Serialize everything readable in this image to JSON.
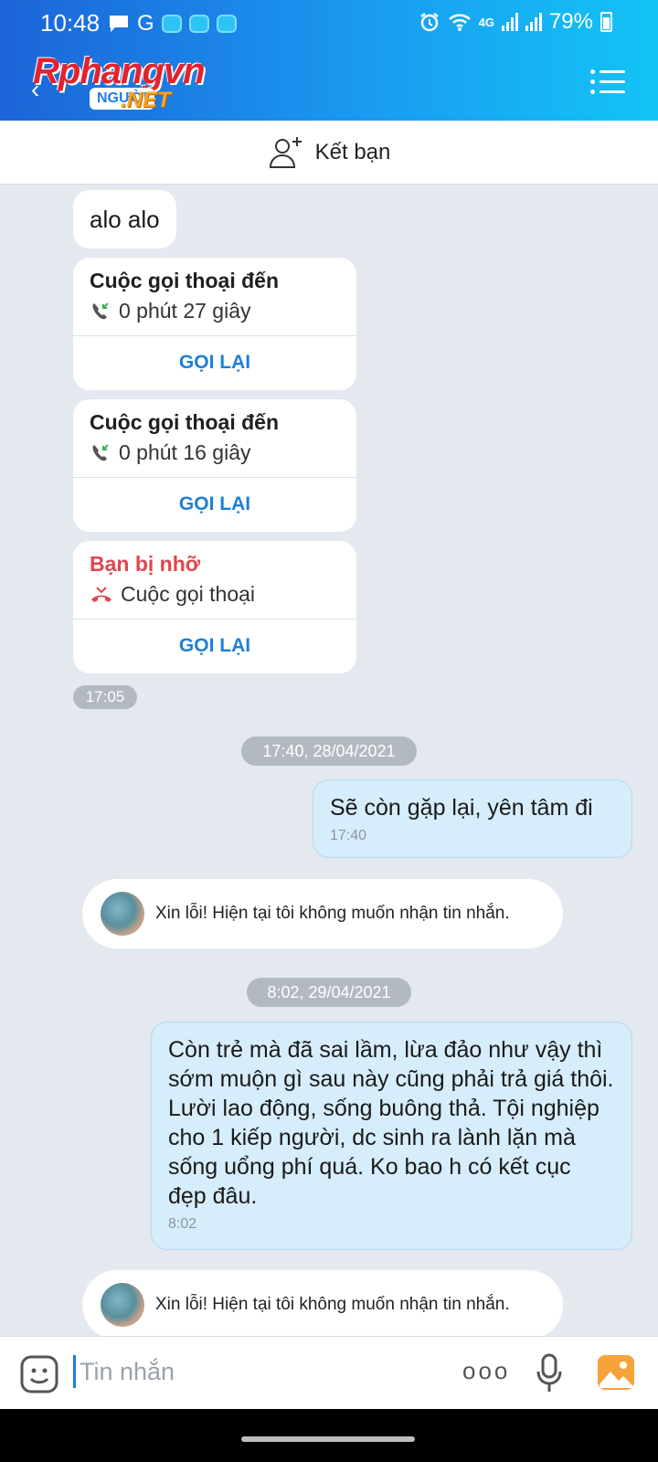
{
  "status_bar": {
    "time": "10:48",
    "network": "4G",
    "battery": "79%"
  },
  "app_bar": {
    "logo_text": "Rphangvn",
    "logo_sub": "NGƯỜI",
    "logo_net": ".NET",
    "accent": "#1a9af0"
  },
  "add_friend": {
    "label": "Kết bạn"
  },
  "messages": {
    "greeting": "alo alo",
    "calls": [
      {
        "title": "Cuộc gọi thoại đến",
        "detail": "0 phút 27 giây",
        "action": "GỌI LẠI"
      },
      {
        "title": "Cuộc gọi thoại đến",
        "detail": "0 phút 16 giây",
        "action": "GỌI LẠI"
      },
      {
        "title": "Bạn bị nhỡ",
        "detail": "Cuộc gọi thoại",
        "action": "GỌI LẠI"
      }
    ],
    "calls_time": "17:05",
    "date1": "17:40, 28/04/2021",
    "out1": {
      "text": "Sẽ còn gặp lại, yên tâm đi",
      "time": "17:40"
    },
    "system1": "Xin lỗi! Hiện tại tôi không muốn nhận tin nhắn.",
    "date2": "8:02, 29/04/2021",
    "out2": {
      "text": "Còn trẻ mà đã sai lầm, lừa đảo như vậy thì sớm muộn gì sau này cũng phải trả giá thôi. Lười lao động, sống buông thả. Tội nghiệp cho 1 kiếp người, dc sinh ra lành lặn mà sống uổng phí quá. Ko bao h có kết cục đẹp đâu.",
      "time": "8:02"
    },
    "system2": "Xin lỗi! Hiện tại tôi không muốn nhận tin nhắn."
  },
  "composer": {
    "placeholder": "Tin nhắn",
    "more_label": "ooo"
  },
  "colors": {
    "call_action": "#1f7fd6",
    "missed": "#e0464f",
    "outgoing_bg": "#d6edfb"
  }
}
